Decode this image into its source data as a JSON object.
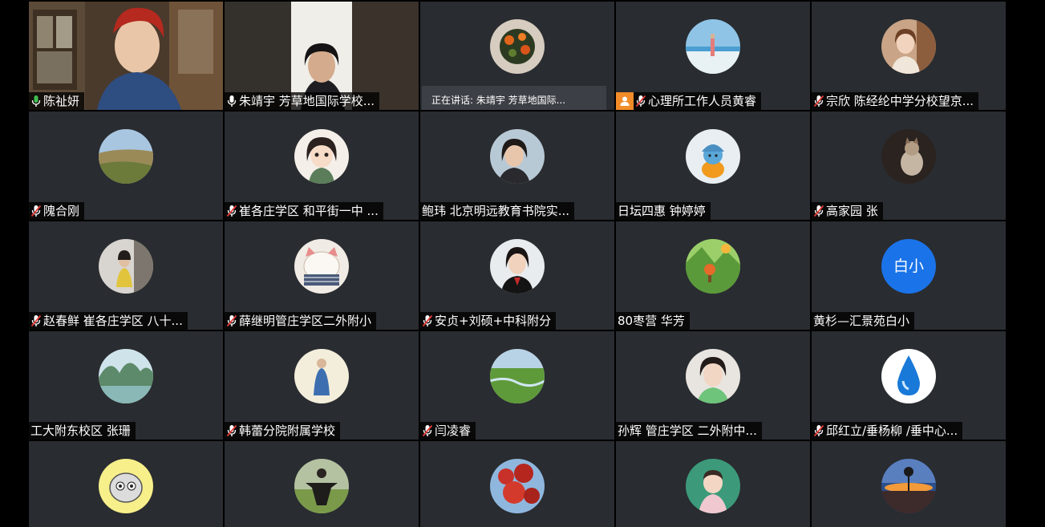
{
  "speaking_indicator": "正在讲话: 朱靖宇  芳草地国际...",
  "participants": [
    {
      "name": "陈祉妍",
      "mic": "on"
    },
    {
      "name": "朱靖宇  芳草地国际学校...",
      "mic": "on"
    },
    {
      "name": "",
      "mic": "none"
    },
    {
      "name": "心理所工作人员黄睿",
      "mic": "muted"
    },
    {
      "name": "宗欣 陈经纶中学分校望京...",
      "mic": "muted"
    },
    {
      "name": "隗合刚",
      "mic": "muted"
    },
    {
      "name": "崔各庄学区 和平街一中 ...",
      "mic": "muted"
    },
    {
      "name": "鲍玮 北京明远教育书院实...",
      "mic": "none"
    },
    {
      "name": "日坛四惠 钟婷婷",
      "mic": "none"
    },
    {
      "name": "高家园 张",
      "mic": "muted"
    },
    {
      "name": "赵春鲜  崔各庄学区 八十...",
      "mic": "muted"
    },
    {
      "name": "薛继明管庄学区二外附小",
      "mic": "muted"
    },
    {
      "name": "安贞+刘硕+中科附分",
      "mic": "muted"
    },
    {
      "name": "80枣营 华芳",
      "mic": "none"
    },
    {
      "name": "黄杉—汇景苑白小",
      "mic": "none"
    },
    {
      "name": "工大附东校区  张珊",
      "mic": "none"
    },
    {
      "name": "韩蕾分院附属学校",
      "mic": "muted"
    },
    {
      "name": "闫凌睿",
      "mic": "muted"
    },
    {
      "name": "孙辉 管庄学区  二外附中...",
      "mic": "none"
    },
    {
      "name": "邱红立/垂杨柳 /垂中心...",
      "mic": "muted"
    }
  ],
  "text_avatar_label": "白小",
  "colors": {
    "tile_bg": "#292c30",
    "role_badge": "#f28c28",
    "text_avatar": "#1a73e8"
  }
}
